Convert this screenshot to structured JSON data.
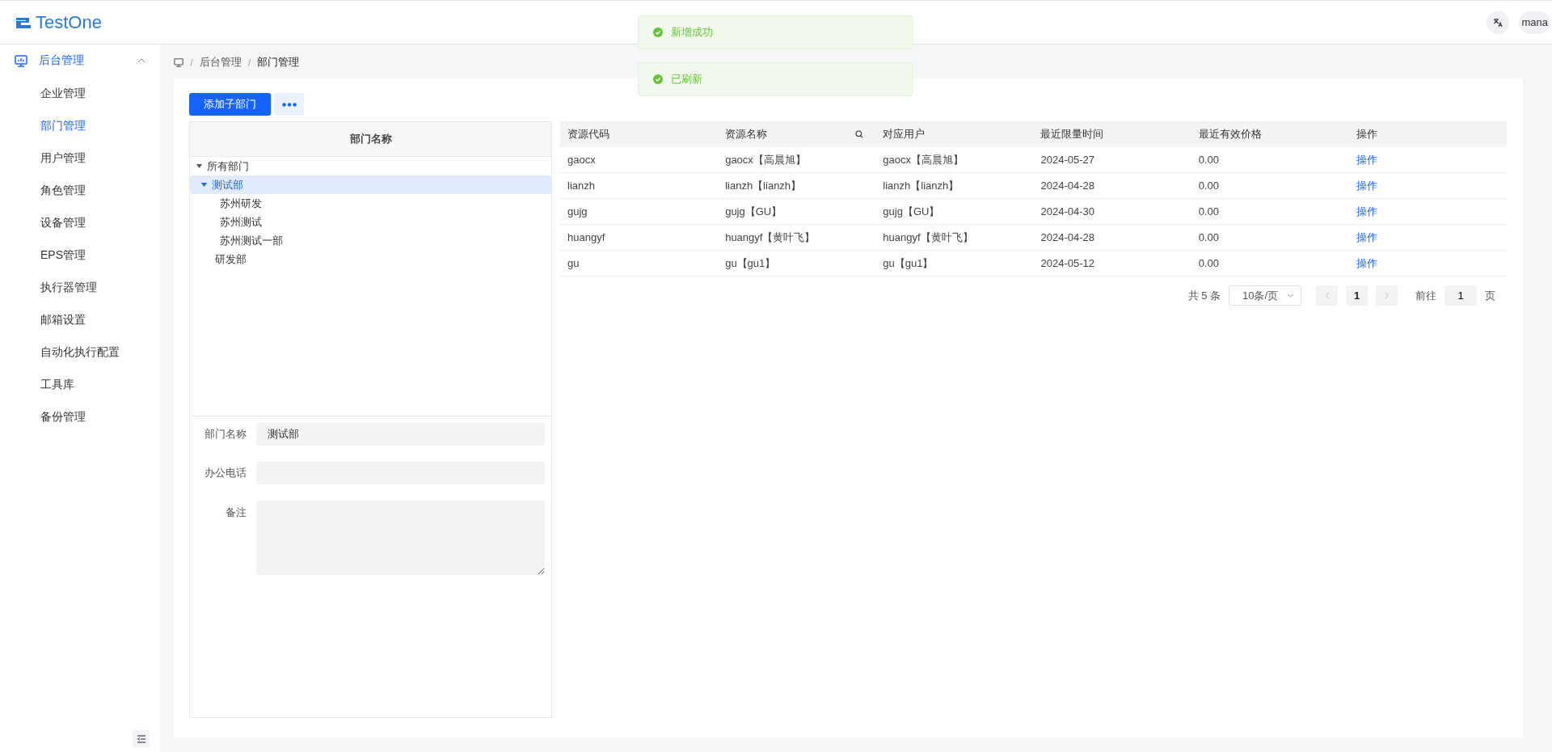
{
  "header": {
    "logo": "TestOne",
    "user": "mana"
  },
  "toasts": [
    {
      "text": "新增成功"
    },
    {
      "text": "已刷新"
    }
  ],
  "sidebar": {
    "group": {
      "label": "后台管理",
      "expanded": true
    },
    "items": [
      {
        "label": "企业管理",
        "selected": false
      },
      {
        "label": "部门管理",
        "selected": true
      },
      {
        "label": "用户管理",
        "selected": false
      },
      {
        "label": "角色管理",
        "selected": false
      },
      {
        "label": "设备管理",
        "selected": false
      },
      {
        "label": "EPS管理",
        "selected": false
      },
      {
        "label": "执行器管理",
        "selected": false
      },
      {
        "label": "邮箱设置",
        "selected": false
      },
      {
        "label": "自动化执行配置",
        "selected": false
      },
      {
        "label": "工具库",
        "selected": false
      },
      {
        "label": "备份管理",
        "selected": false
      }
    ]
  },
  "breadcrumb": [
    {
      "separator": "/",
      "label": "后台管理"
    },
    {
      "separator": "/",
      "label": "部门管理"
    }
  ],
  "toolbar": {
    "add_button": "添加子部门"
  },
  "tree": {
    "heading": "部门名称",
    "nodes": [
      {
        "label": "所有部门",
        "expanded": true,
        "selected": false,
        "children": [
          {
            "label": "测试部",
            "expanded": true,
            "selected": true,
            "children": [
              {
                "label": "苏州研发",
                "selected": false
              },
              {
                "label": "苏州测试",
                "selected": false
              },
              {
                "label": "苏州测试一部",
                "selected": false
              }
            ]
          },
          {
            "label": "研发部",
            "selected": false
          }
        ]
      }
    ]
  },
  "form": {
    "fields": [
      {
        "label": "部门名称",
        "value": "测试部",
        "kind": "input"
      },
      {
        "label": "办公电话",
        "kind": "input"
      },
      {
        "label": "备注",
        "kind": "textarea"
      }
    ]
  },
  "table": {
    "columns": [
      {
        "label": "资源代码",
        "searchable": false
      },
      {
        "label": "资源名称",
        "searchable": true
      },
      {
        "label": "对应用户",
        "searchable": false
      },
      {
        "label": "最近限量时间",
        "searchable": false
      },
      {
        "label": "最近有效价格",
        "searchable": false
      },
      {
        "label": "操作",
        "searchable": false
      }
    ],
    "rows": [
      [
        "gaocx",
        "gaocx【高晨旭】",
        "gaocx【高晨旭】",
        "2024-05-27",
        "0.00",
        "操作"
      ],
      [
        "lianzh",
        "lianzh【lianzh】",
        "lianzh【lianzh】",
        "2024-04-28",
        "0.00",
        "操作"
      ],
      [
        "gujg",
        "gujg【GU】",
        "gujg【GU】",
        "2024-04-30",
        "0.00",
        "操作"
      ],
      [
        "huangyf",
        "huangyf【黄叶飞】",
        "huangyf【黄叶飞】",
        "2024-04-28",
        "0.00",
        "操作"
      ],
      [
        "gu",
        "gu【gu1】",
        "gu【gu1】",
        "2024-05-12",
        "0.00",
        "操作"
      ]
    ]
  },
  "pagination": {
    "total": "共 5 条",
    "page_size": "10条/页",
    "pages": [
      {
        "label": "1",
        "selected": true
      }
    ],
    "goto_label": "前往",
    "goto_value": "1",
    "goto_suffix": "页"
  }
}
